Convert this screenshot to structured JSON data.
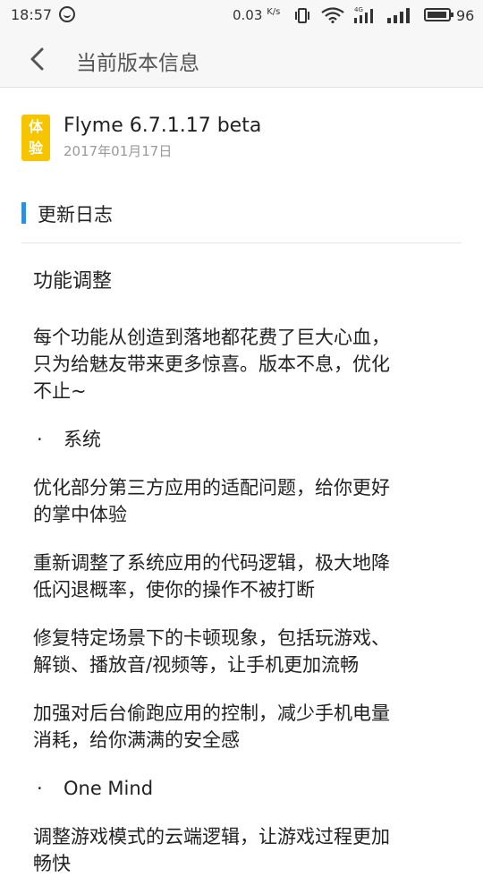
{
  "status_bar": {
    "time": "18:57",
    "speed_value": "0.03",
    "speed_unit": "K/s",
    "battery_percent": "96",
    "battery_level": 0.96,
    "network_type": "4G"
  },
  "header": {
    "title": "当前版本信息"
  },
  "version": {
    "badge_line1": "体",
    "badge_line2": "验",
    "name": "Flyme 6.7.1.17 beta",
    "date": "2017年01月17日"
  },
  "changelog": {
    "section_title": "更新日志",
    "heading": "功能调整",
    "intro_line1": "每个功能从创造到落地都花费了巨大心血，",
    "intro_line2": "只为给魅友带来更多惊喜。版本不息，优化",
    "intro_line3": "不止~",
    "bullet_system": "系统",
    "item1_line1": "优化部分第三方应用的适配问题，给你更好",
    "item1_line2": "的掌中体验",
    "item2_line1": "重新调整了系统应用的代码逻辑，极大地降",
    "item2_line2": "低闪退概率，使你的操作不被打断",
    "item3_line1": "修复特定场景下的卡顿现象，包括玩游戏、",
    "item3_line2": "解锁、播放音/视频等，让手机更加流畅",
    "item4_line1": "加强对后台偷跑应用的控制，减少手机电量",
    "item4_line2": "消耗，给你满满的安全感",
    "bullet_onemind": "One Mind",
    "item5_line1": "调整游戏模式的云端逻辑，让游戏过程更加",
    "item5_line2": "畅快"
  },
  "colors": {
    "badge": "#f7c400",
    "accent_bar": "#2f8fdc",
    "date_gray": "#9a9a9a"
  }
}
